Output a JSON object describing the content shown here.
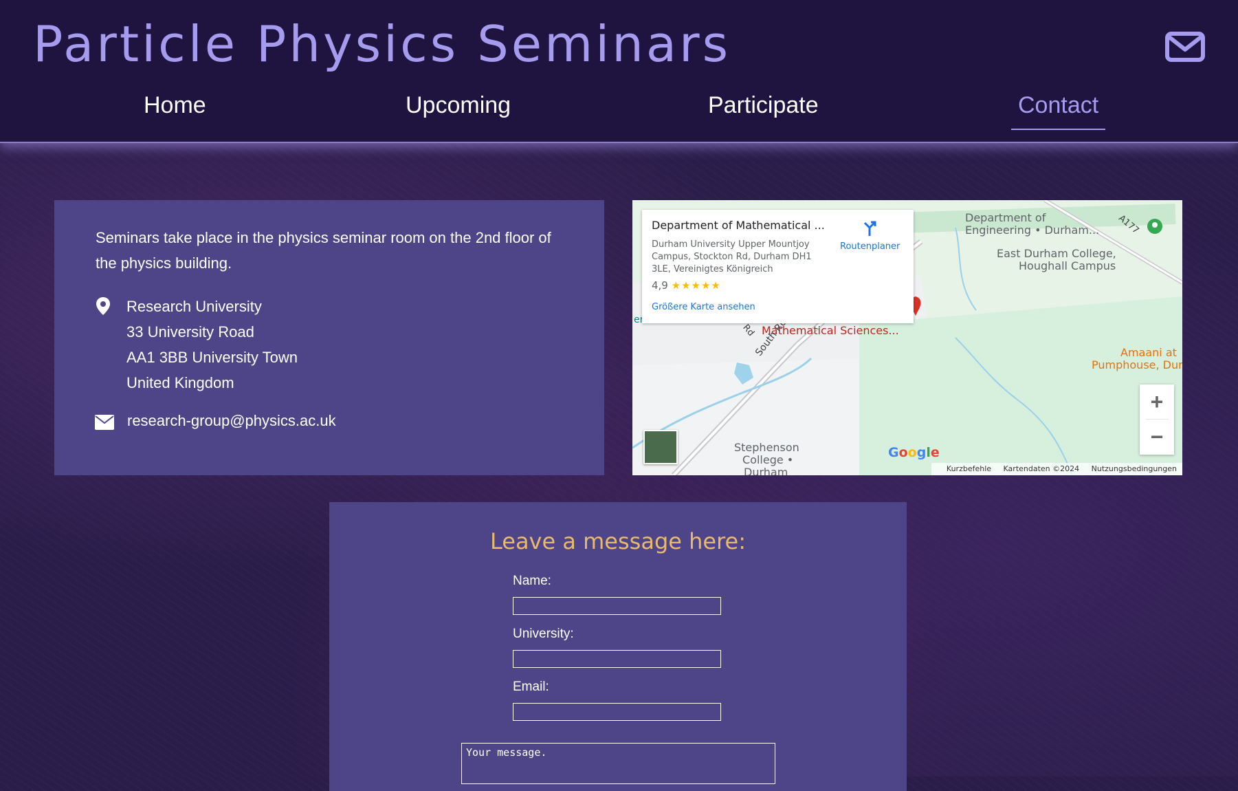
{
  "header": {
    "title": "Particle Physics Seminars",
    "mail_icon": "envelope-icon"
  },
  "nav": {
    "items": [
      {
        "label": "Home",
        "active": false
      },
      {
        "label": "Upcoming",
        "active": false
      },
      {
        "label": "Participate",
        "active": false
      },
      {
        "label": "Contact",
        "active": true
      }
    ]
  },
  "info": {
    "description": "Seminars take place in the physics seminar room on the 2nd floor of the physics building.",
    "address": [
      "Research University",
      "33 University Road",
      "AA1 3BB University Town",
      "United Kingdom"
    ],
    "email": "research-group@physics.ac.uk"
  },
  "map": {
    "place_title": "Department of Mathematical ...",
    "place_address": "Durham University Upper Mountjoy Campus, Stockton Rd, Durham DH1 3LE, Vereinigtes Königreich",
    "rating": "4,9",
    "rating_stars": "★★★★★",
    "larger_map_link": "Größere Karte ansehen",
    "directions_label": "Routenplaner",
    "labels": {
      "dept_engineering_1": "Department of",
      "dept_engineering_2": "Engineering • Durham...",
      "east_durham_1": "East Durham College,",
      "east_durham_2": "Houghall Campus",
      "math_sciences": "Mathematical Sciences...",
      "oriental_museum": "ental Museum",
      "south_rd": "South Rd",
      "rd": "Rd",
      "a177": "A177",
      "amaani_1": "Amaani at",
      "amaani_2": "Pumphouse, Durl",
      "stephenson_1": "Stephenson",
      "stephenson_2": "College •",
      "stephenson_3": "Durham"
    },
    "footer": [
      "Kurzbefehle",
      "Kartendaten ©2024",
      "Nutzungsbedingungen"
    ],
    "google_logo": "Google",
    "zoom_in": "+",
    "zoom_out": "−"
  },
  "form": {
    "heading": "Leave a message here:",
    "name_label": "Name:",
    "university_label": "University:",
    "email_label": "Email:",
    "message_placeholder": "Your message."
  },
  "colors": {
    "header_bg": "#1f1440",
    "accent": "#a59cf0",
    "card_bg": "#4e4588",
    "form_heading": "#e9b96e",
    "page_bg": "#2a1d4a"
  }
}
